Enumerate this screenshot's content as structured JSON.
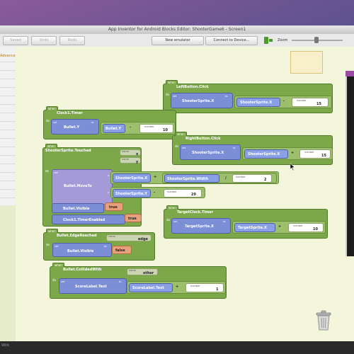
{
  "window": {
    "title": "App Inventor for Android Blocks Editor: ShooterGame6 - Screen1"
  },
  "toolbar": {
    "saved": "Saved",
    "undo": "Undo",
    "redo": "Redo",
    "new_emulator": "New emulator",
    "connect_device": "Connect to Device...",
    "zoom": "Zoom"
  },
  "palette": {
    "advanced": "Advanced"
  },
  "status": {
    "text": "Wirk"
  },
  "blocks": {
    "left_click": {
      "event": "LeftButton.Click",
      "set_prop": "ShooterSprite.X",
      "get_prop": "ShooterSprite.X",
      "op": "-",
      "number": "15"
    },
    "right_click": {
      "event": "RightButton.Click",
      "set_prop": "ShooterSprite.X",
      "get_prop": "ShooterSprite.X",
      "op": "+",
      "number": "15"
    },
    "clock_timer": {
      "event": "Clock1.Timer",
      "set_prop": "Bullet.Y",
      "get_prop": "Bullet.Y",
      "op": "-",
      "number": "10"
    },
    "shooter_touched": {
      "event": "ShooterSprite.Touched",
      "arg_x": "x",
      "arg_y": "y",
      "call": "Bullet.MoveTo",
      "x_label": "x",
      "y_label": "y",
      "get_x": "ShooterSprite.X",
      "get_width": "ShooterSprite.Width",
      "op_plus": "+",
      "op_div": "/",
      "number_2": "2",
      "get_y": "ShooterSprite.Y",
      "op_minus": "-",
      "number_20": "20",
      "set_visible": "Bullet.Visible",
      "visible_val": "true",
      "set_timer": "Clock1.TimerEnabled",
      "timer_val": "true"
    },
    "target_timer": {
      "event": "TargetClock.Timer",
      "set_prop": "TargetSprite.X",
      "get_prop": "TargetSprite.X",
      "op": "+",
      "number": "10"
    },
    "edge_reached": {
      "event": "Bullet.EdgeReached",
      "arg": "edge",
      "set_prop": "Bullet.Visible",
      "value": "false"
    },
    "collided": {
      "event": "Bullet.CollidedWith",
      "arg": "other",
      "set_prop": "ScoreLabel.Text",
      "get_prop": "ScoreLabel.Text",
      "op": "+",
      "number": "1"
    },
    "labels": {
      "when": "when",
      "do": "do",
      "set": "set",
      "to": "to",
      "name": "name",
      "number": "number",
      "call": "call"
    }
  },
  "colors": {
    "event_block": "#7da84a",
    "setter_block": "#7c8fd6",
    "getter_block": "#8aa0e6",
    "math_block": "#9bbf6a",
    "logic_block": "#e8a07c",
    "workspace": "#f4f6dc"
  },
  "icons": {
    "trash": "trash-can-icon",
    "cursor": "pointer-cursor-icon",
    "zoom": "zoom-slider-icon",
    "device": "android-device-icon"
  }
}
